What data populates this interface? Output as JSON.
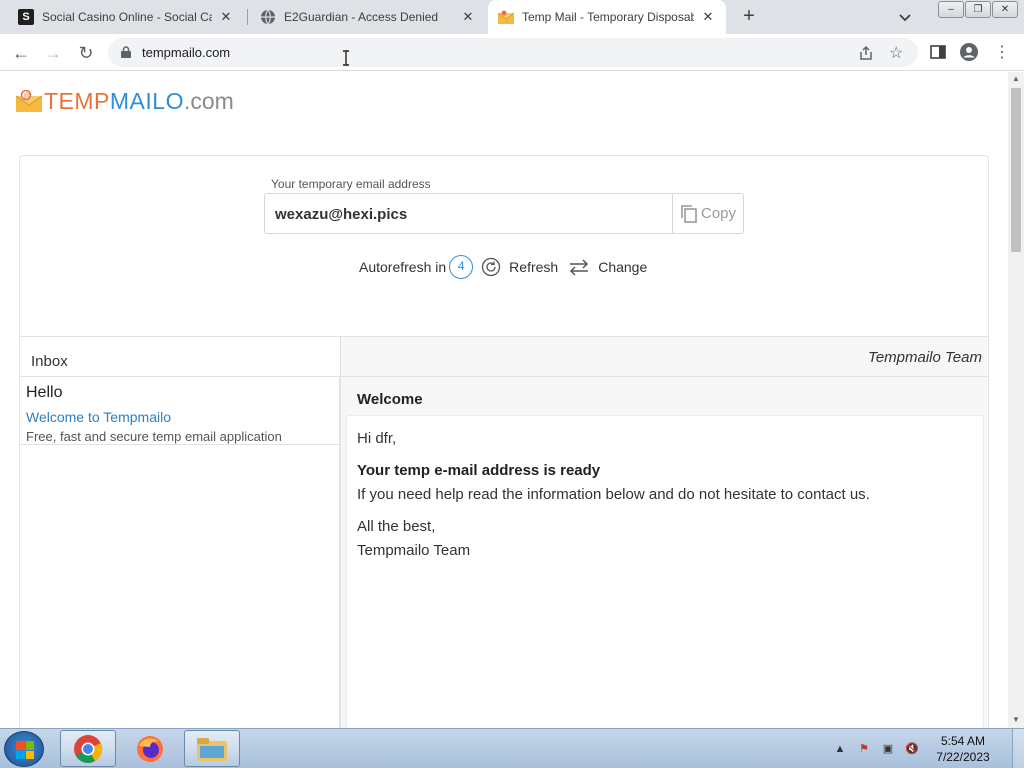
{
  "browser": {
    "tabs": [
      {
        "title": "Social Casino Online - Social Casino",
        "favicon": "S",
        "active": false
      },
      {
        "title": "E2Guardian - Access Denied",
        "favicon": "globe-icon",
        "active": false
      },
      {
        "title": "Temp Mail - Temporary Disposable",
        "favicon": "envelope-icon",
        "active": true
      }
    ],
    "new_tab_label": "+",
    "url": "tempmailo.com"
  },
  "page": {
    "logo": {
      "part1": "TEMP",
      "part2": "MAILO",
      "part3": ".com"
    },
    "address_label": "Your temporary email address",
    "email_address": "wexazu@hexi.pics",
    "copy_label": "Copy",
    "autorefresh_label": "Autorefresh in",
    "autorefresh_count": "4",
    "refresh_label": "Refresh",
    "change_label": "Change",
    "inbox_title": "Inbox",
    "message_sender_header": "Tempmailo Team",
    "inbox": [
      {
        "from": "Hello",
        "subject": "Welcome to Tempmailo",
        "preview": "Free, fast and secure temp email application"
      }
    ],
    "message": {
      "subject": "Welcome",
      "greeting": "Hi dfr,",
      "heading": "Your temp e-mail address is ready",
      "line1": "If you need help read the information below and do not hesitate to contact us.",
      "signoff": "All the best,",
      "signature": "Tempmailo Team"
    }
  },
  "taskbar": {
    "time": "5:54 AM",
    "date": "7/22/2023"
  },
  "colors": {
    "brand_orange": "#e8743b",
    "brand_blue": "#2d8fd5",
    "link_blue": "#2d7fc1"
  }
}
